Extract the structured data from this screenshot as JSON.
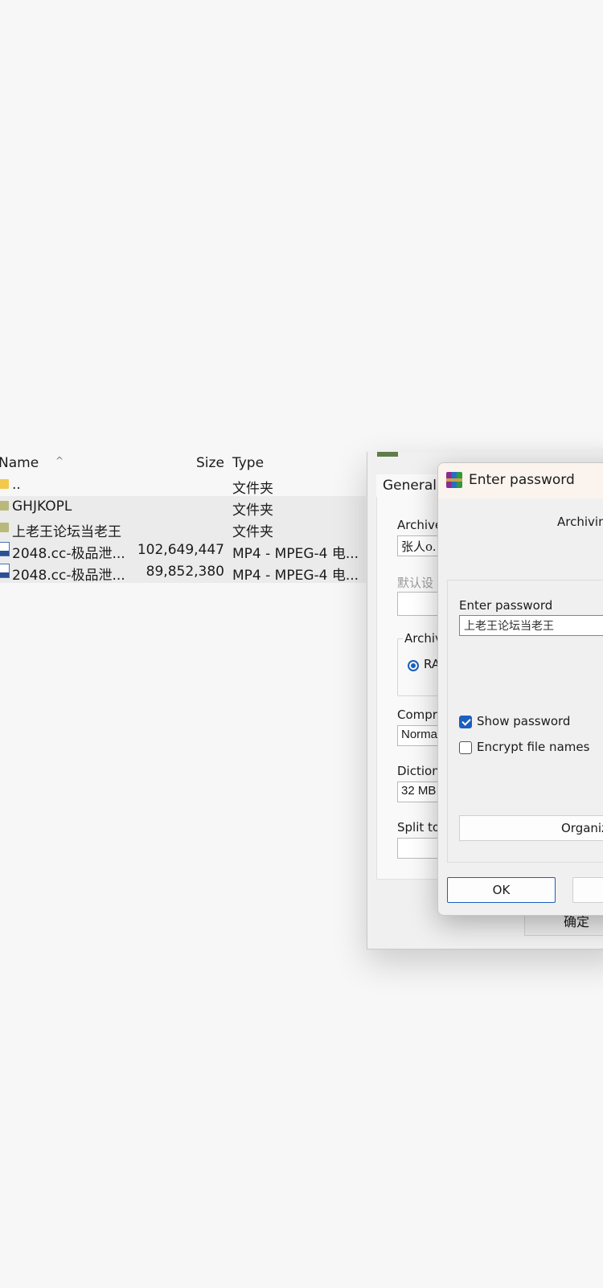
{
  "file_list": {
    "columns": {
      "name": "Name",
      "size": "Size",
      "type": "Type"
    },
    "sort_indicator": "^",
    "rows": [
      {
        "icon": "folder-up-icon",
        "name": "..",
        "size": "",
        "type": "文件夹"
      },
      {
        "icon": "folder-icon",
        "name": "GHJKOPL",
        "size": "",
        "type": "文件夹"
      },
      {
        "icon": "folder-icon",
        "name": "上老王论坛当老王",
        "size": "",
        "type": "文件夹"
      },
      {
        "icon": "video-file-icon",
        "name": "2048.cc-极品泄...",
        "size": "102,649,447",
        "type": "MP4 - MPEG-4 电..."
      },
      {
        "icon": "video-file-icon",
        "name": "2048.cc-极品泄...",
        "size": "89,852,380",
        "type": "MP4 - MPEG-4 电..."
      }
    ]
  },
  "archive_dialog": {
    "tab_general": "General",
    "archive_name_label": "Archive",
    "archive_name_value": "张人o.",
    "profile_label": "默认设",
    "archive_format_label": "Archiv",
    "rar_option": "RA",
    "compression_label": "Compre",
    "compression_value": "Norma",
    "dictionary_label": "Dictiona",
    "dictionary_value": "32 MB",
    "split_label": "Split to",
    "ok_label": "确定"
  },
  "password_dialog": {
    "title": "Enter password",
    "subtitle": "Archivin",
    "enter_password_label": "Enter password",
    "password_value": "上老王论坛当老王",
    "show_password_label": "Show password",
    "show_password_checked": true,
    "encrypt_file_names_label": "Encrypt file names",
    "encrypt_file_names_checked": false,
    "organize_label": "Organiz",
    "ok_label": "OK"
  }
}
